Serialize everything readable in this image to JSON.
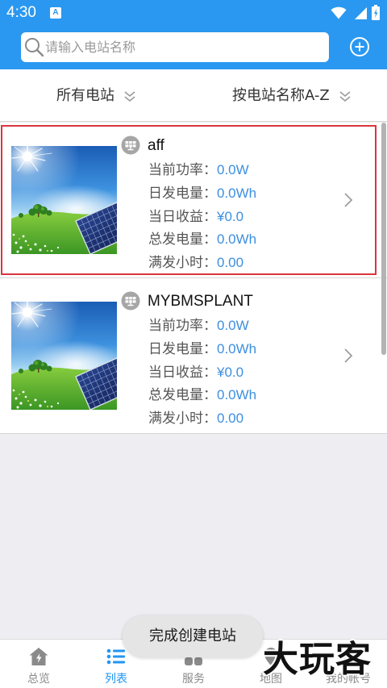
{
  "status_bar": {
    "time": "4:30",
    "notification_icon": "A",
    "icons": [
      "wifi-icon",
      "signal-icon",
      "battery-icon"
    ]
  },
  "search": {
    "placeholder": "请输入电站名称",
    "value": "",
    "search_icon": "search-icon",
    "add_icon": "add-circle-icon"
  },
  "filters": {
    "station_filter": "所有电站",
    "sort_order": "按电站名称A-Z"
  },
  "plants": [
    {
      "name": "aff",
      "selected": true,
      "fields": [
        {
          "label": "当前功率：",
          "value": "0.0W"
        },
        {
          "label": "日发电量：",
          "value": "0.0Wh"
        },
        {
          "label": "当日收益：",
          "value": "¥0.0"
        },
        {
          "label": "总发电量：",
          "value": "0.0Wh"
        },
        {
          "label": "满发小时：",
          "value": "0.00"
        }
      ]
    },
    {
      "name": "MYBMSPLANT",
      "selected": false,
      "fields": [
        {
          "label": "当前功率：",
          "value": "0.0W"
        },
        {
          "label": "日发电量：",
          "value": "0.0Wh"
        },
        {
          "label": "当日收益：",
          "value": "¥0.0"
        },
        {
          "label": "总发电量：",
          "value": "0.0Wh"
        },
        {
          "label": "满发小时：",
          "value": "0.00"
        }
      ]
    }
  ],
  "toast": {
    "message": "完成创建电站"
  },
  "tab_bar": {
    "active": 1,
    "tabs": [
      {
        "label": "总览",
        "icon": "home-icon"
      },
      {
        "label": "列表",
        "icon": "list-icon"
      },
      {
        "label": "服务",
        "icon": "grid-icon"
      },
      {
        "label": "地图",
        "icon": "map-icon"
      },
      {
        "label": "我的帐号",
        "icon": "account-icon"
      }
    ]
  },
  "watermark": "大玩客",
  "colors": {
    "primary": "#2A98F0",
    "value_text": "#3C8FE0",
    "selection_border": "#D9363E",
    "active_tab": "#2196F3",
    "inactive_tab": "#8A8A8A"
  }
}
